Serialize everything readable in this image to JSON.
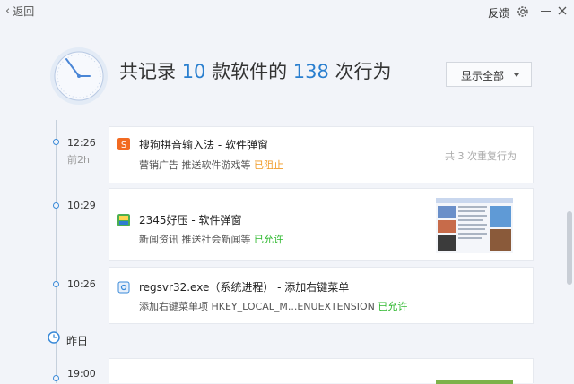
{
  "nav": {
    "back": "返回",
    "feedback": "反馈"
  },
  "summary": {
    "prefix": "共记录 ",
    "software_count": "10",
    "mid": " 款软件的 ",
    "behavior_count": "138",
    "suffix": " 次行为"
  },
  "filter": {
    "selected": "显示全部"
  },
  "entries": [
    {
      "time": "12:26",
      "ago": "前2h",
      "title": "搜狗拼音输入法 - 软件弹窗",
      "desc": "营销广告 推送软件游戏等 ",
      "status": "已阻止",
      "note": "共 3 次重复行为"
    },
    {
      "time": "10:29",
      "title": "2345好压 - 软件弹窗",
      "desc": "新闻资讯 推送社会新闻等 ",
      "status": "已允许"
    },
    {
      "time": "10:26",
      "title": "regsvr32.exe（系统进程） - 添加右键菜单",
      "desc": "添加右键菜单项 HKEY_LOCAL_M...ENUEXTENSION ",
      "status": "已允许"
    }
  ],
  "day_header": "昨日",
  "next_time": "19:00",
  "colors": {
    "accent": "#2a7fcf",
    "allowed": "#2eb82e",
    "blocked": "#f09a26"
  }
}
